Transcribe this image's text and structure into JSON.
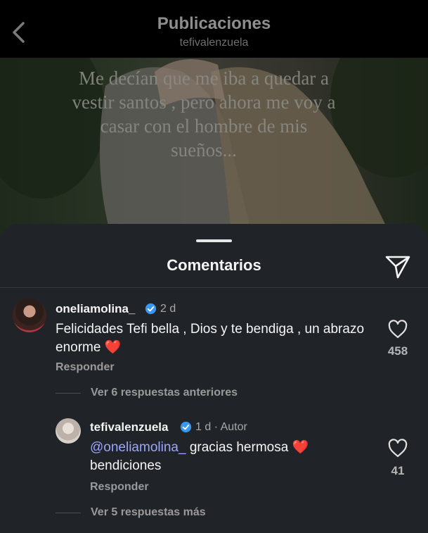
{
  "header": {
    "title": "Publicaciones",
    "username": "tefivalenzuela"
  },
  "photo": {
    "caption": "Me decían que me iba a quedar a vestir santos , pero ahora me voy a casar con el hombre de mis sueños..."
  },
  "comments_sheet": {
    "title": "Comentarios",
    "comments": [
      {
        "username": "oneliamolina_",
        "verified": true,
        "time": "2 d",
        "text": "Felicidades Tefi bella , Dios y te bendiga , un abrazo enorme",
        "emoji": "❤️",
        "reply_label": "Responder",
        "likes": "458",
        "view_replies": "Ver 6 respuestas anteriores"
      },
      {
        "username": "tefivalenzuela",
        "verified": true,
        "time": "1 d",
        "separator": "·",
        "author_tag": "Autor",
        "mention": "@oneliamolina_",
        "text": "gracias hermosa",
        "emoji": "❤️",
        "text_line2": "bendiciones",
        "reply_label": "Responder",
        "likes": "41",
        "view_replies": "Ver 5 respuestas más"
      }
    ]
  },
  "colors": {
    "sheet_bg": "#202327",
    "mention": "#9aa6ff",
    "verified": "#3897f0",
    "heart": "#ed2a2a"
  },
  "icons": [
    "chevron-left-icon",
    "share-icon",
    "verified-icon",
    "heart-outline-icon",
    "heart-emoji-icon"
  ]
}
